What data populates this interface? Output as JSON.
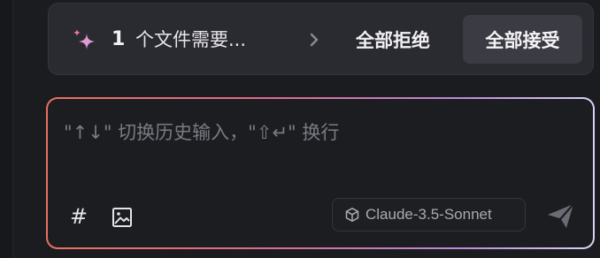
{
  "pending_changes": {
    "count": "1",
    "text": "个文件需要...",
    "reject_all_label": "全部拒绝",
    "accept_all_label": "全部接受",
    "icon": "sparkle-icon",
    "expand_icon": "chevron-right-icon"
  },
  "chat_input": {
    "placeholder": "\"↑↓\" 切换历史输入，\"⇧↵\" 换行",
    "value": ""
  },
  "toolbar": {
    "hash_label": "#",
    "image_icon": "image-icon",
    "model_icon": "cube-icon",
    "model_label": "Claude-3.5-Sonnet",
    "send_icon": "send-icon"
  },
  "colors": {
    "background": "#1b1c20",
    "bar_background": "#2a2b31",
    "accept_button_bg": "#3b3c43",
    "border_gradient": [
      "#e9705e",
      "#dc6b8e",
      "#b98ad6",
      "#d7d2f2"
    ],
    "sparkle_pink": "#f48fb1",
    "sparkle_purple": "#c7a6f4"
  }
}
